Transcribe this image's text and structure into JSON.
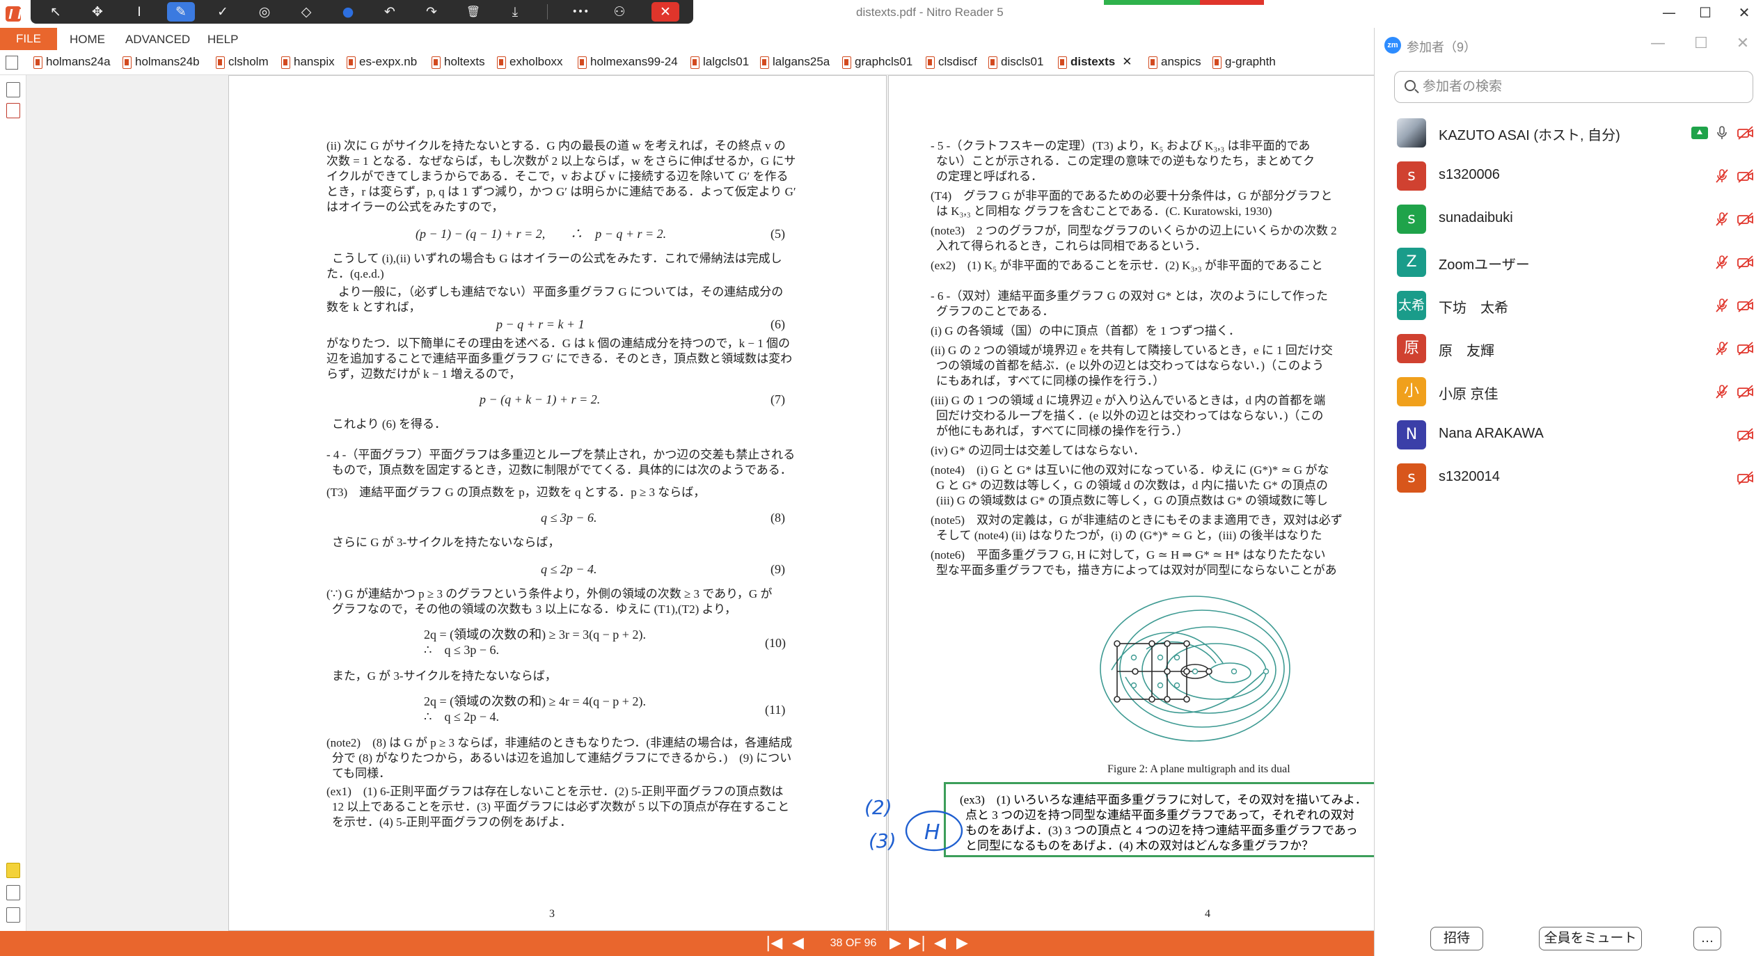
{
  "window": {
    "title": "distexts.pdf - Nitro Reader 5",
    "minimize": "—",
    "maximize": "☐",
    "close": "✕"
  },
  "toolbar": {
    "tools": [
      {
        "icon": "select-arrow-icon",
        "glyph": "↖"
      },
      {
        "icon": "pan-move-icon",
        "glyph": "✥"
      },
      {
        "icon": "text-cursor-icon",
        "glyph": "I"
      },
      {
        "icon": "pen-icon",
        "glyph": "✎"
      },
      {
        "icon": "checkmark-icon",
        "glyph": "✓"
      },
      {
        "icon": "spotlight-icon",
        "glyph": "◎"
      },
      {
        "icon": "eraser-icon",
        "glyph": "◇"
      },
      {
        "icon": "color-picker-icon",
        "glyph": "●"
      },
      {
        "icon": "undo-icon",
        "glyph": "↶"
      },
      {
        "icon": "redo-icon",
        "glyph": "↷"
      },
      {
        "icon": "trash-icon",
        "glyph": "🗑"
      },
      {
        "icon": "save-icon",
        "glyph": "⤓"
      },
      {
        "icon": "more-icon",
        "glyph": "•••"
      },
      {
        "icon": "request-control-icon",
        "glyph": "⚇"
      },
      {
        "icon": "close-icon",
        "glyph": "✕"
      }
    ],
    "active_color": "#3b7ae0"
  },
  "menu": {
    "file": "FILE",
    "home": "HOME",
    "advanced": "ADVANCED",
    "help": "HELP"
  },
  "tabs": [
    {
      "label": "holmans24a"
    },
    {
      "label": "holmans24b"
    },
    {
      "label": "clsholm"
    },
    {
      "label": "hanspix"
    },
    {
      "label": "es-expx.nb"
    },
    {
      "label": "holtexts"
    },
    {
      "label": "exholboxx"
    },
    {
      "label": "holmexans99-24"
    },
    {
      "label": "lalgcls01"
    },
    {
      "label": "lalgans25a"
    },
    {
      "label": "graphcls01"
    },
    {
      "label": "clsdiscf"
    },
    {
      "label": "discls01"
    },
    {
      "label": "distexts",
      "active": true,
      "close": "✕"
    },
    {
      "label": "anspics"
    },
    {
      "label": "g-graphth"
    }
  ],
  "page_left": {
    "lines": [
      "(ii) 次に G がサイクルを持たないとする．G 内の最長の道 w を考えれば，その終点 v の",
      "次数 = 1 となる．なぜならば，もし次数が 2 以上ならば，w をさらに伸ばせるか，G にサ",
      "イクルができてしまうからである．そこで，v および v に接続する辺を除いて G′ を作る",
      "とき，r は変らず，p, q は 1 ずつ減り，かつ G′ は明らかに連結である．よって仮定より G′",
      "はオイラーの公式をみたすので，"
    ],
    "eq5": "(p − 1) − (q − 1) + r = 2,　　∴　p − q + r = 2.",
    "eq5_no": "(5)",
    "lines2": [
      "こうして (i),(ii) いずれの場合も G はオイラーの公式をみたす．これで帰納法は完成し",
      "た．(q.e.d.)",
      "　より一般に，（必ずしも連結でない）平面多重グラフ G については，その連結成分の",
      "数を k とすれば，"
    ],
    "eq6": "p − q + r = k + 1",
    "eq6_no": "(6)",
    "lines3": [
      "がなりたつ．以下簡単にその理由を述べる．G は k 個の連結成分を持つので，k − 1 個の",
      "辺を追加することで連結平面多重グラフ G′ にできる．そのとき，頂点数と領域数は変わ",
      "らず，辺数だけが k − 1 増えるので，"
    ],
    "eq7": "p − (q + k − 1) + r = 2.",
    "eq7_no": "(7)",
    "after7": "これより (6) を得る．",
    "sec4": [
      "- 4 -（平面グラフ）平面グラフは多重辺とループを禁止され，かつ辺の交差も禁止される",
      "もので，頂点数を固定するとき，辺数に制限がでてくる．具体的には次のようである．",
      "(T3)　連結平面グラフ G の頂点数を p，辺数を q とする．p ≥ 3 ならば，"
    ],
    "eq8": "q ≤ 3p − 6.",
    "eq8_no": "(8)",
    "mid8": "さらに G が 3-サイクルを持たないならば，",
    "eq9": "q ≤ 2p − 4.",
    "eq9_no": "(9)",
    "proof": [
      "(∵) G が連結かつ p ≥ 3 のグラフという条件より，外側の領域の次数 ≥ 3 であり，G が",
      "グラフなので，その他の領域の次数も 3 以上になる．ゆえに (T1),(T2) より，"
    ],
    "eq10a": "2q = (領域の次数の和) ≥ 3r = 3(q − p + 2).",
    "eq10b": "∴　q ≤ 3p − 6.",
    "eq10_no": "(10)",
    "mid10": "また，G が 3-サイクルを持たないならば，",
    "eq11a": "2q = (領域の次数の和) ≥ 4r = 4(q − p + 2).",
    "eq11b": "∴　q ≤ 2p − 4.",
    "eq11_no": "(11)",
    "notes": [
      "(note2)　(8) は G が p ≥ 3 ならば，非連結のときもなりたつ．(非連結の場合は，各連結成",
      "分で (8) がなりたつから，あるいは辺を追加して連結グラフにできるから．)　(9) につい",
      "ても同様．",
      "(ex1)　(1) 6-正則平面グラフは存在しないことを示せ．(2) 5-正則平面グラフの頂点数は",
      "12 以上であることを示せ．(3) 平面グラフには必ず次数が 5 以下の頂点が存在すること",
      "を示せ．(4) 5-正則平面グラフの例をあげよ．"
    ],
    "page_number": "3"
  },
  "page_right": {
    "lines": [
      "- 5 -（クラトフスキーの定理）(T3) より，K₅ および K₃,₃ は非平面的であ",
      "ない）ことが示される．この定理の意味での逆もなりたち，まとめてク",
      "の定理と呼ばれる．",
      "(T4)　グラフ G が非平面的であるための必要十分条件は，G が部分グラフと",
      "は K₃,₃ と同相な グラフを含むことである．(C. Kuratowski, 1930)",
      "(note3)　2 つのグラフが，同型なグラフのいくらかの辺上にいくらかの次数 2",
      "入れて得られるとき，これらは同相であるという．",
      "(ex2)　(1) K₅ が非平面的であることを示せ．(2) K₃,₃ が非平面的であること",
      "",
      "- 6 -（双対）連結平面多重グラフ G の双対 G* とは，次のようにして作った",
      "グラフのことである．",
      "(i) G の各領域（国）の中に頂点（首都）を 1 つずつ描く．",
      "(ii) G の 2 つの領域が境界辺 e を共有して隣接しているとき，e に 1 回だけ交",
      "つの領域の首都を結ぶ．(e 以外の辺とは交わってはならない．)（このよう",
      "にもあれば，すべてに同様の操作を行う．）",
      "(iii) G の 1 つの領域 d に境界辺 e が入り込んでいるときは，d 内の首都を端",
      "回だけ交わるループを描く．(e 以外の辺とは交わってはならない．)（この",
      "が他にもあれば，すべてに同様の操作を行う．）",
      "(iv) G* の辺同士は交差してはならない．",
      "(note4)　(i) G と G* は互いに他の双対になっている．ゆえに (G*)* ≃ G がな",
      "G と G* の辺数は等しく，G の領域 d の次数は，d 内に描いた G* の頂点の",
      "(iii) G の領域数は G* の頂点数に等しく，G の頂点数は G* の領域数に等し",
      "(note5)　双対の定義は，G が非連結のときにもそのまま適用でき，双対は必ず",
      "そして (note4) (ii) はなりたつが，(i) の (G*)* ≃ G と，(iii) の後半はなりた",
      "(note6)　平面多重グラフ G, H に対して，G ≃ H ⇒ G* ≃ H* はなりたたない",
      "型な平面多重グラフでも，描き方によっては双対が同型にならないことがあ"
    ],
    "figure_caption": "Figure 2: A plane multigraph and its dual",
    "ex3": [
      "(ex3)　(1) いろいろな連結平面多重グラフに対して，その双対を描いてみよ．",
      "点と 3 つの辺を持つ同型な連結平面多重グラフであって，それぞれの双対",
      "ものをあげよ．(3) 3 つの頂点と 4 つの辺を持つ連結平面多重グラフであっ",
      "と同型になるものをあげよ．(4) 木の双対はどんな多重グラフか？"
    ],
    "page_number": "4"
  },
  "handwriting": {
    "line1": "(2)",
    "line2": "(3)",
    "circled": "H",
    "ink_color": "#1f5fd0"
  },
  "pager": {
    "label": "38 OF 96",
    "first": "|◀",
    "prev": "◀",
    "next": "▶",
    "last": "▶|",
    "back": "◀",
    "forward": "▶"
  },
  "zoom": {
    "logo": "zm",
    "title": "参加者（9）",
    "search_placeholder": "参加者の検索",
    "participants": [
      {
        "name": "KAZUTO ASAI (ホスト, 自分)",
        "avatar": "",
        "color": "#7a8694",
        "photo": true,
        "mic": "on",
        "cam": "off",
        "sharing": true
      },
      {
        "name": "s1320006",
        "avatar": "s",
        "color": "#d04130",
        "mic": "off",
        "cam": "off"
      },
      {
        "name": "sunadaibuki",
        "avatar": "s",
        "color": "#1fa34a",
        "mic": "off",
        "cam": "off"
      },
      {
        "name": "Zoomユーザー",
        "avatar": "Z",
        "color": "#1a9c8a",
        "mic": "off",
        "cam": "off"
      },
      {
        "name": "下坊　太希",
        "avatar": "太希",
        "color": "#1a9c8a",
        "mic": "off",
        "cam": "off"
      },
      {
        "name": "原　友輝",
        "avatar": "原",
        "color": "#d04130",
        "mic": "off",
        "cam": "off"
      },
      {
        "name": "小原 京佳",
        "avatar": "小",
        "color": "#f0a01c",
        "mic": "off",
        "cam": "off"
      },
      {
        "name": "Nana ARAKAWA",
        "avatar": "N",
        "color": "#3b3fa8",
        "mic": "none",
        "cam": "off"
      },
      {
        "name": "s1320014",
        "avatar": "s",
        "color": "#d8561b",
        "mic": "none",
        "cam": "off"
      }
    ],
    "invite": "招待",
    "mute_all": "全員をミュート",
    "more": "…"
  },
  "colors": {
    "nitro_orange": "#e9662d",
    "zoom_blue": "#2d8cff",
    "muted_red": "#e0352b",
    "highlight_box": "#3c9e5a"
  }
}
